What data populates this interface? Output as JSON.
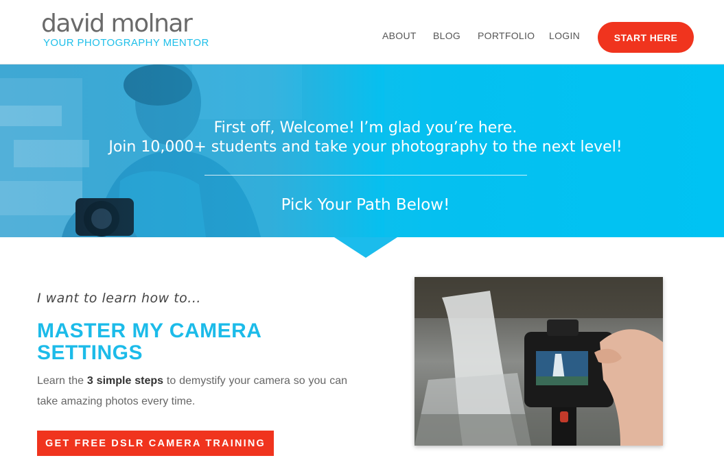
{
  "header": {
    "logo": {
      "main": "david molnar",
      "tagline": "YOUR PHOTOGRAPHY MENTOR"
    },
    "nav": [
      {
        "label": "ABOUT"
      },
      {
        "label": "BLOG"
      },
      {
        "label": "PORTFOLIO"
      },
      {
        "label": "LOGIN"
      }
    ],
    "cta_label": "START HERE"
  },
  "hero": {
    "line1": "First off, Welcome! I’m glad you’re here.",
    "line2": "Join 10,000+ students and take your photography to the next level!",
    "cta": "Pick Your Path Below!"
  },
  "path": {
    "intro": "I want to learn how to...",
    "title": "MASTER MY CAMERA SETTINGS",
    "desc_before": "Learn the ",
    "desc_bold": "3 simple steps",
    "desc_after": " to demystify your camera so you can take amazing photos every time.",
    "button_label": "GET FREE DSLR CAMERA TRAINING"
  },
  "colors": {
    "accent": "#1cbbe9",
    "button": "#f0341e",
    "nav_text": "#555555"
  }
}
